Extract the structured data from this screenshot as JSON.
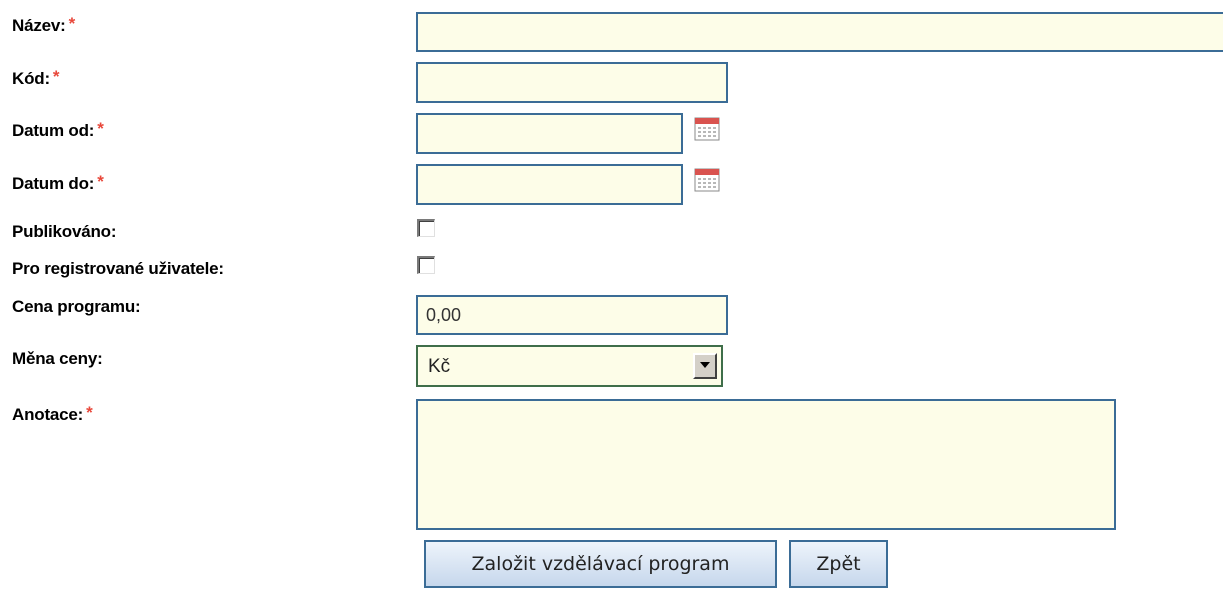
{
  "form": {
    "fields": {
      "nazev": {
        "label": "Název:",
        "required_mark": "*",
        "value": ""
      },
      "kod": {
        "label": "Kód:",
        "required_mark": "*",
        "value": ""
      },
      "datum_od": {
        "label": "Datum od:",
        "required_mark": "*",
        "value": ""
      },
      "datum_do": {
        "label": "Datum do:",
        "required_mark": "*",
        "value": ""
      },
      "publikovano": {
        "label": "Publikováno:",
        "checked": false
      },
      "pro_registrovane": {
        "label": "Pro registrované uživatele:",
        "checked": false
      },
      "cena": {
        "label": "Cena programu:",
        "value": "0,00"
      },
      "mena": {
        "label": "Měna ceny:",
        "selected": "Kč"
      },
      "anotace": {
        "label": "Anotace:",
        "required_mark": "*",
        "value": ""
      }
    },
    "buttons": {
      "submit_label": "Založit vzdělávací program",
      "back_label": "Zpět"
    }
  },
  "icons": {
    "calendar": "calendar-icon",
    "dropdown": "chevron-down-icon"
  },
  "colors": {
    "required_mark": "#e8473a",
    "input_background": "#fdfde8",
    "input_border": "#3b6c96"
  }
}
